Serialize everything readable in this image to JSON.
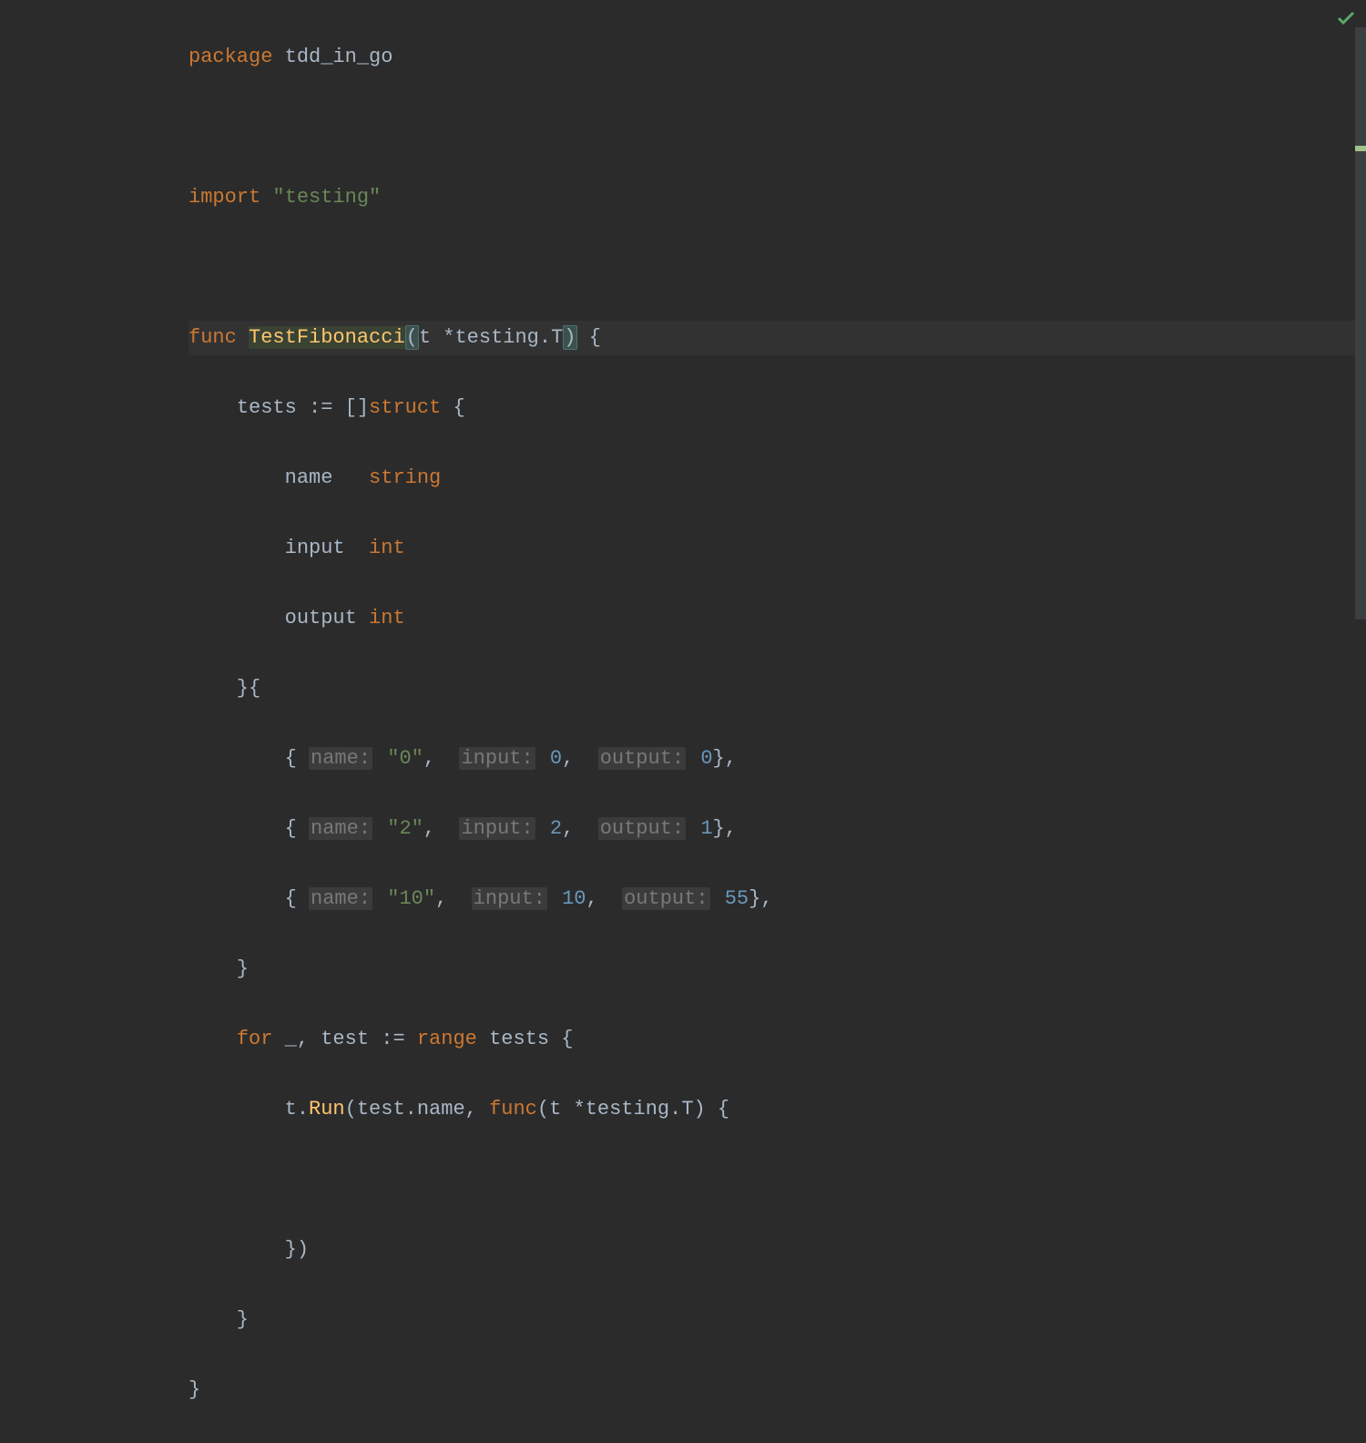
{
  "code": {
    "package_kw": "package",
    "package_name": "tdd_in_go",
    "import_kw": "import",
    "import_path": "\"testing\"",
    "func_kw": "func",
    "func_name": "TestFibonacci",
    "param_t": "t *testing.",
    "param_T": "T",
    "tests_var": "tests",
    "assign": ":=",
    "struct_kw": "struct",
    "field_name": "name",
    "field_input": "input",
    "field_output": "output",
    "type_string": "string",
    "type_int": "int",
    "hint_name": "name:",
    "hint_input": "input:",
    "hint_output": "output:",
    "row1_name": "\"0\"",
    "row1_input": "0",
    "row1_output": "0",
    "row2_name": "\"2\"",
    "row2_input": "2",
    "row2_output": "1",
    "row3_name": "\"10\"",
    "row3_input": "10",
    "row3_output": "55",
    "for_kw": "for",
    "range_kw": "range",
    "underscore": "_",
    "test_var": "test",
    "t_run": "t.",
    "run_method": "Run",
    "test_name": "test.name",
    "inner_func": "func",
    "inner_param": "(t *testing.T)"
  }
}
